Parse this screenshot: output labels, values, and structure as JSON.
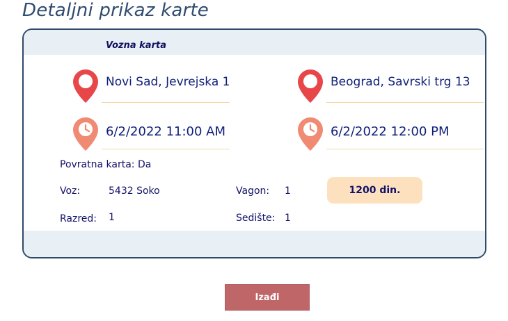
{
  "page": {
    "title": "Detaljni prikaz karte"
  },
  "ticket": {
    "type_label": "Vozna karta",
    "departure_location": "Novi Sad, Jevrejska 1",
    "arrival_location": "Beograd, Savrski trg 13",
    "departure_time": "6/2/2022 11:00 AM",
    "arrival_time": "6/2/2022 12:00 PM",
    "return_ticket": "Povratna karta: Da",
    "train_label": "Voz:",
    "train_value": "5432 Soko",
    "wagon_label": "Vagon:",
    "wagon_value": "1",
    "class_label": "Razred:",
    "class_value": "1",
    "seat_label": "Sedište:",
    "seat_value": "1",
    "price": "1200 din."
  },
  "actions": {
    "exit_label": "Izađi"
  },
  "icons": {
    "location": "map-pin-icon",
    "time": "clock-pin-icon"
  },
  "colors": {
    "location_pin": "#e8474a",
    "time_pin": "#f08a73",
    "accent": "#bf6669",
    "text": "#12126a",
    "price_bg": "#fde1bf"
  }
}
